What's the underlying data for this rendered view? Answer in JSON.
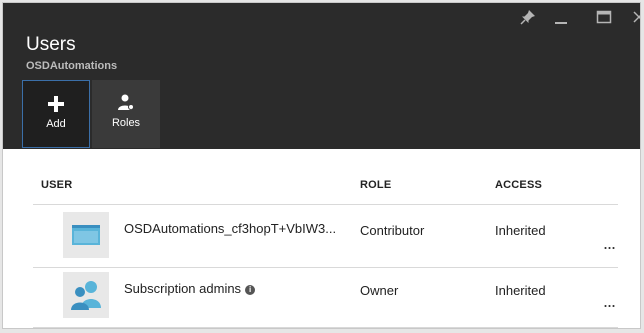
{
  "window": {
    "controls": [
      {
        "name": "pin-icon"
      },
      {
        "name": "minimize-icon"
      },
      {
        "name": "maximize-icon"
      },
      {
        "name": "close-icon"
      }
    ]
  },
  "header": {
    "title": "Users",
    "subtitle": "OSDAutomations"
  },
  "toolbar": {
    "add_label": "Add",
    "roles_label": "Roles",
    "add_icon": "plus-icon",
    "roles_icon": "roles-icon"
  },
  "table": {
    "columns": {
      "user": "USER",
      "role": "ROLE",
      "access": "ACCESS"
    },
    "rows": [
      {
        "user": "OSDAutomations_cf3hopT+VbIW3...",
        "role": "Contributor",
        "access": "Inherited",
        "icon": "application-icon",
        "more": "..."
      },
      {
        "user": "Subscription admins",
        "role": "Owner",
        "access": "Inherited",
        "icon": "user-group-icon",
        "info_icon": "info-icon",
        "more": "..."
      }
    ]
  },
  "colors": {
    "header_bg": "#2b2b2b",
    "accent": "#59b4d9",
    "selected_border": "#3b6fa8"
  }
}
